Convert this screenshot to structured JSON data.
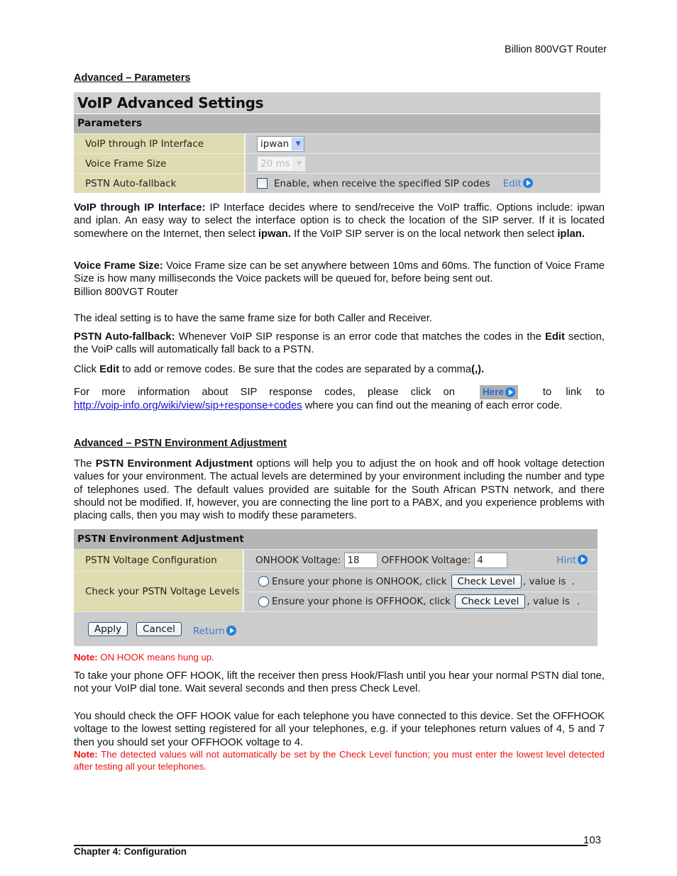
{
  "header": {
    "doc_title": "Billion 800VGT Router"
  },
  "section1": {
    "title": "Advanced – Parameters",
    "panel": {
      "title": "VoIP Advanced Settings",
      "subtitle": "Parameters",
      "rows": [
        {
          "label": "VoIP through IP Interface",
          "select_value": "ipwan"
        },
        {
          "label": "Voice Frame Size",
          "select_value": "20 ms",
          "disabled": true
        },
        {
          "label": "PSTN Auto-fallback",
          "checkbox_label": "Enable, when receive the specified SIP codes",
          "checked": false,
          "link": "Edit"
        }
      ]
    },
    "p1": {
      "bold": "VoIP through IP Interface:",
      "t1": " IP Interface decides where to send/receive the VoIP traffic. Options include: ipwan and iplan.    An easy way to select the interface option is to check the location of the SIP server.    If it is located somewhere on the Internet, then select ",
      "b2": "ipwan.",
      "t2": "    If the VoIP SIP server is on the local network then select ",
      "b3": "iplan."
    },
    "p2": {
      "bold": "Voice Frame Size:",
      "t1": " Voice Frame size can be set anywhere between 10ms and 60ms. The function of Voice Frame Size is how many milliseconds the Voice packets will be queued for, before being sent out.",
      "t2": "Billion 800VGT Router"
    },
    "p3": "The ideal setting is to have the same frame size for both Caller and Receiver.",
    "p4": {
      "bold": "PSTN Auto-fallback:",
      "t1": " Whenever VoIP SIP response is an error code that matches the codes in the ",
      "b2": "Edit",
      "t2": " section, the VoiP calls will automatically fall back to a PSTN."
    },
    "p5": {
      "t1": "Click ",
      "b1": "Edit",
      "t2": " to add or remove codes. Be sure that the codes are separated by a comma",
      "b2": "(,)."
    },
    "p6": {
      "t1": "For more information about SIP response codes, please click on",
      "here_label": "Here",
      "t2": "to link to",
      "url": "http://voip-info.org/wiki/view/sip+response+codes",
      "t3": " where you can find out the meaning of each error code."
    }
  },
  "section2": {
    "title": "Advanced – PSTN Environment Adjustment",
    "p1": {
      "t1": "The ",
      "bold": "PSTN Environment Adjustment",
      "t2": " options will help you to adjust the on hook and off hook voltage detection values for your environment.   The actual levels are determined by your environment including the number and type of telephones used. The default values provided are suitable for the South African PSTN network, and there should not be modified. If, however, you are connecting the line port to a PABX, and you experience problems with placing calls, then you may wish to modify these parameters."
    },
    "panel": {
      "subtitle": "PSTN Environment Adjustment",
      "voltage_label": "PSTN Voltage Configuration",
      "onhook_label": "ONHOOK Voltage:",
      "onhook_value": "18",
      "offhook_label": "OFFHOOK Voltage:",
      "offhook_value": "4",
      "hint_link": "Hint",
      "check_label": "Check your PSTN Voltage Levels",
      "onhook_check_text": "Ensure your phone is ONHOOK, click",
      "offhook_check_text": "Ensure your phone is OFFHOOK, click",
      "check_button": "Check Level",
      "value_is": ", value is",
      "value_end": ".",
      "apply": "Apply",
      "cancel": "Cancel",
      "return": "Return"
    },
    "note1": {
      "bold": "Note:",
      "text": " ON HOOK means hung up."
    },
    "p2": "To take your phone OFF HOOK, lift the receiver then press Hook/Flash until you hear your normal PSTN dial tone, not your VoIP dial tone. Wait several seconds and then press Check Level.",
    "p3": "You should check the OFF HOOK value for each telephone you have connected to this device. Set the OFFHOOK voltage to the lowest setting registered for all your telephones, e.g. if your telephones return values of 4, 5 and 7 then you should set your OFFHOOK voltage to 4.",
    "note2": {
      "bold": "Note:",
      "text": " The detected values will not automatically be set by the Check Level function; you must enter the lowest level detected after testing all your telephones."
    }
  },
  "footer": {
    "page_number": "103",
    "chapter": "Chapter 4: Configuration"
  }
}
